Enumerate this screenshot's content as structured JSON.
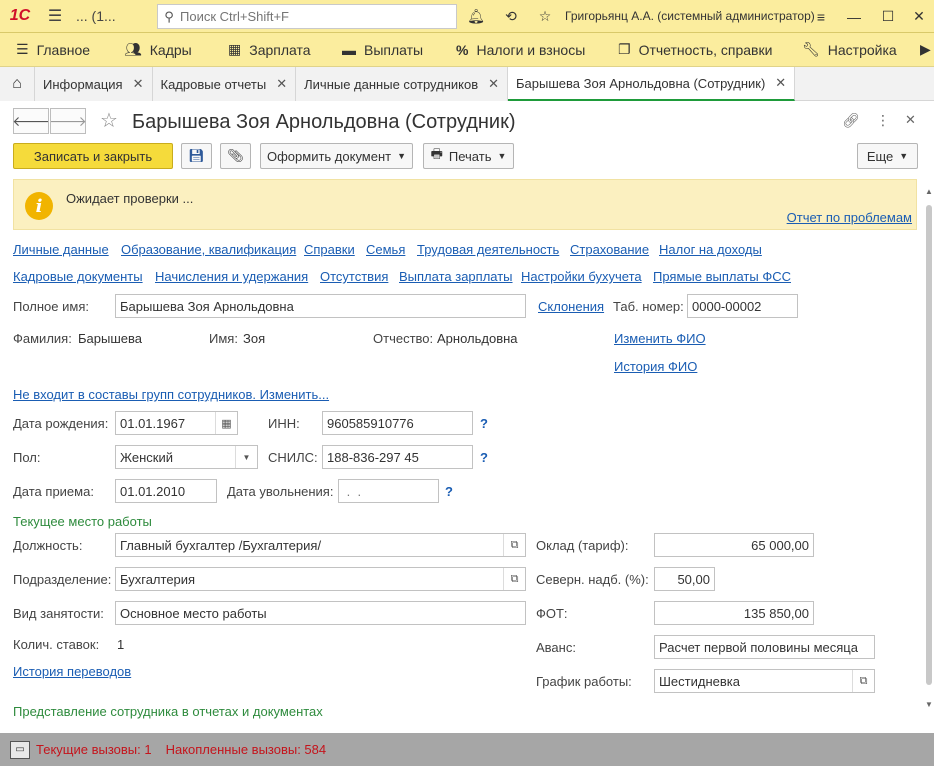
{
  "app": {
    "logo": "1С",
    "window_label": "... (1...",
    "search_placeholder": "Поиск Ctrl+Shift+F",
    "user": "Григорьянц А.А. (системный администратор)"
  },
  "main_menu": [
    {
      "label": "Главное",
      "icon": "menu-icon"
    },
    {
      "label": "Кадры",
      "icon": "people-icon"
    },
    {
      "label": "Зарплата",
      "icon": "calculator-icon"
    },
    {
      "label": "Выплаты",
      "icon": "wallet-icon"
    },
    {
      "label": "Налоги и взносы",
      "icon": "percent-icon"
    },
    {
      "label": "Отчетность, справки",
      "icon": "report-icon"
    },
    {
      "label": "Настройка",
      "icon": "wrench-icon"
    }
  ],
  "tabs": [
    {
      "label": "Информация"
    },
    {
      "label": "Кадровые отчеты"
    },
    {
      "label": "Личные данные сотрудников"
    },
    {
      "label": "Барышева Зоя Арнольдовна (Сотрудник)"
    }
  ],
  "form": {
    "title": "Барышева Зоя Арнольдовна (Сотрудник)",
    "toolbar": {
      "save_close": "Записать и закрыть",
      "make_document": "Оформить документ",
      "print": "Печать",
      "more": "Еще"
    },
    "notice": {
      "text": "Ожидает проверки ...",
      "link": "Отчет по проблемам"
    },
    "nav_links_row1": [
      "Личные данные",
      "Образование, квалификация",
      "Справки",
      "Семья",
      "Трудовая деятельность",
      "Страхование",
      "Налог на доходы"
    ],
    "nav_links_row2": [
      "Кадровые документы",
      "Начисления и удержания",
      "Отсутствия",
      "Выплата зарплаты",
      "Настройки бухучета",
      "Прямые выплаты ФСС"
    ],
    "full_name_label": "Полное имя:",
    "full_name": "Барышева Зоя Арнольдовна",
    "declension_link": "Склонения",
    "tab_number_label": "Таб. номер:",
    "tab_number": "0000-00002",
    "last_name_label": "Фамилия:",
    "last_name": "Барышева",
    "first_name_label": "Имя:",
    "first_name": "Зоя",
    "patronymic_label": "Отчество:",
    "patronymic": "Арнольдовна",
    "change_name_link": "Изменить ФИО",
    "name_history_link": "История ФИО",
    "groups_link": "Не входит в составы групп сотрудников. Изменить...",
    "birth_date_label": "Дата рождения:",
    "birth_date": "01.01.1967",
    "inn_label": "ИНН:",
    "inn": "960585910776",
    "gender_label": "Пол:",
    "gender": "Женский",
    "snils_label": "СНИЛС:",
    "snils": "188-836-297 45",
    "hire_date_label": "Дата приема:",
    "hire_date": "01.01.2010",
    "dismissal_label": "Дата увольнения:",
    "dismissal_date": " .  .",
    "help_mark": "?",
    "current_job_section": "Текущее место работы",
    "position_label": "Должность:",
    "position": "Главный бухгалтер /Бухгалтерия/",
    "department_label": "Подразделение:",
    "department": "Бухгалтерия",
    "employment_label": "Вид занятости:",
    "employment": "Основное место работы",
    "rates_label": "Колич. ставок:",
    "rates": "1",
    "transfer_history_link": "История переводов",
    "salary_label": "Оклад (тариф):",
    "salary": "65 000,00",
    "north_label": "Северн. надб. (%):",
    "north": "50,00",
    "fot_label": "ФОТ:",
    "fot": "135 850,00",
    "advance_label": "Аванс:",
    "advance": "Расчет первой половины месяца",
    "schedule_label": "График работы:",
    "schedule": "Шестидневка",
    "representation_section": "Представление сотрудника в отчетах и документах"
  },
  "status": {
    "current_calls": "Текущие вызовы: 1",
    "accumulated_calls": "Накопленные вызовы: 584"
  },
  "colors": {
    "accent_yellow": "#fbed9e",
    "primary_button": "#f5db3b",
    "link": "#1a5db3",
    "section_green": "#2e8b3d",
    "status_red": "#c4141c"
  }
}
